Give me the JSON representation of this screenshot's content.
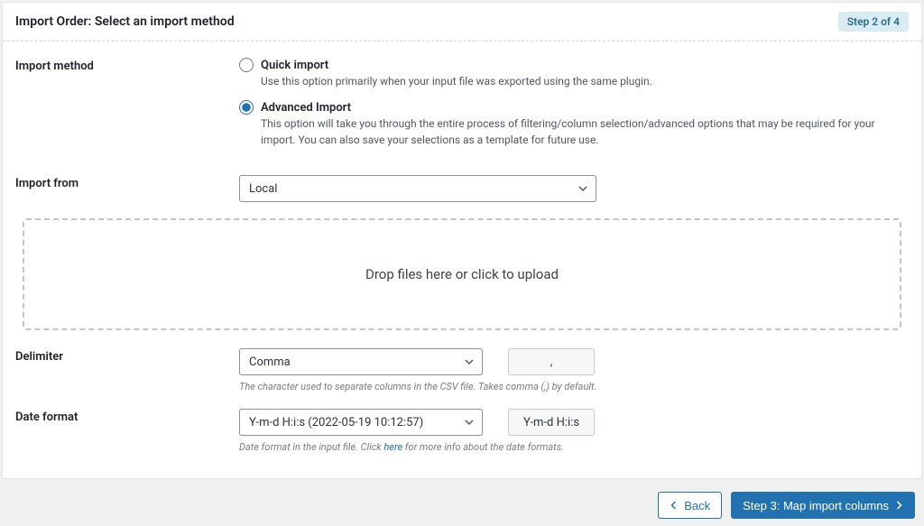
{
  "header": {
    "title": "Import Order: Select an import method",
    "step_badge": "Step 2 of 4"
  },
  "method": {
    "label": "Import method",
    "quick": {
      "title": "Quick import",
      "desc": "Use this option primarily when your input file was exported using the same plugin."
    },
    "advanced": {
      "title": "Advanced Import",
      "desc": "This option will take you through the entire process of filtering/column selection/advanced options that may be required for your import. You can also save your selections as a template for future use."
    }
  },
  "from": {
    "label": "Import from",
    "selected": "Local"
  },
  "dropzone": {
    "text": "Drop files here or click to upload"
  },
  "delimiter": {
    "label": "Delimiter",
    "selected": "Comma",
    "preview": ",",
    "hint": "The character used to separate columns in the CSV file. Takes comma (,) by default."
  },
  "date": {
    "label": "Date format",
    "selected": "Y-m-d H:i:s (2022-05-19 10:12:57)",
    "preview": "Y-m-d H:i:s",
    "hint_before": "Date format in the input file. Click ",
    "hint_link": "here",
    "hint_after": " for more info about the date formats."
  },
  "footer": {
    "back": "Back",
    "next": "Step 3: Map import columns"
  }
}
